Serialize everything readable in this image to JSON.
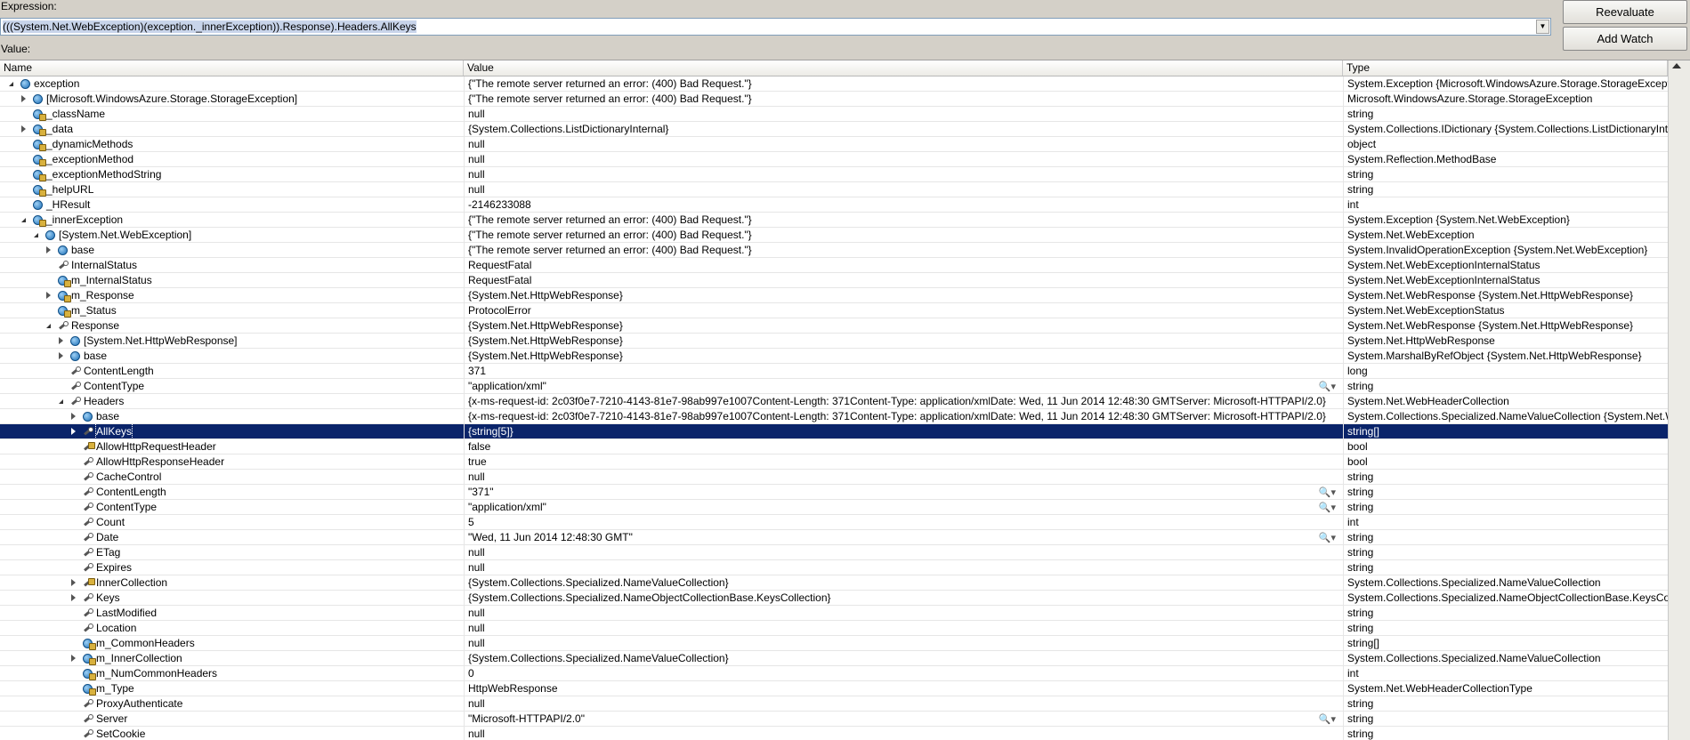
{
  "window": {
    "expression_label": "Expression:",
    "expression_value": "(((System.Net.WebException)(exception._innerException)).Response).Headers.AllKeys",
    "value_label": "Value:",
    "reevaluate_button": "Reevaluate",
    "add_watch_button": "Add Watch"
  },
  "grid": {
    "columns": [
      "Name",
      "Value",
      "Type"
    ],
    "rows": [
      {
        "name": "exception",
        "value": "{\"The remote server returned an error: (400) Bad Request.\"}",
        "type": "System.Exception {Microsoft.WindowsAzure.Storage.StorageException}",
        "depth": 0,
        "expander": "expanded",
        "icon": "field",
        "private": false,
        "mag": false
      },
      {
        "name": "[Microsoft.WindowsAzure.Storage.StorageException]",
        "value": "{\"The remote server returned an error: (400) Bad Request.\"}",
        "type": "Microsoft.WindowsAzure.Storage.StorageException",
        "depth": 1,
        "expander": "collapsed",
        "icon": "field",
        "private": false,
        "mag": false
      },
      {
        "name": "_className",
        "value": "null",
        "type": "string",
        "depth": 1,
        "expander": "none",
        "icon": "field",
        "private": true,
        "mag": false
      },
      {
        "name": "_data",
        "value": "{System.Collections.ListDictionaryInternal}",
        "type": "System.Collections.IDictionary {System.Collections.ListDictionaryInternal}",
        "depth": 1,
        "expander": "collapsed",
        "icon": "field",
        "private": true,
        "mag": false
      },
      {
        "name": "_dynamicMethods",
        "value": "null",
        "type": "object",
        "depth": 1,
        "expander": "none",
        "icon": "field",
        "private": true,
        "mag": false
      },
      {
        "name": "_exceptionMethod",
        "value": "null",
        "type": "System.Reflection.MethodBase",
        "depth": 1,
        "expander": "none",
        "icon": "field",
        "private": true,
        "mag": false
      },
      {
        "name": "_exceptionMethodString",
        "value": "null",
        "type": "string",
        "depth": 1,
        "expander": "none",
        "icon": "field",
        "private": true,
        "mag": false
      },
      {
        "name": "_helpURL",
        "value": "null",
        "type": "string",
        "depth": 1,
        "expander": "none",
        "icon": "field",
        "private": true,
        "mag": false
      },
      {
        "name": "_HResult",
        "value": "-2146233088",
        "type": "int",
        "depth": 1,
        "expander": "none",
        "icon": "field",
        "private": false,
        "mag": false
      },
      {
        "name": "_innerException",
        "value": "{\"The remote server returned an error: (400) Bad Request.\"}",
        "type": "System.Exception {System.Net.WebException}",
        "depth": 1,
        "expander": "expanded",
        "icon": "field",
        "private": true,
        "mag": false
      },
      {
        "name": "[System.Net.WebException]",
        "value": "{\"The remote server returned an error: (400) Bad Request.\"}",
        "type": "System.Net.WebException",
        "depth": 2,
        "expander": "expanded",
        "icon": "field",
        "private": false,
        "mag": false
      },
      {
        "name": "base",
        "value": "{\"The remote server returned an error: (400) Bad Request.\"}",
        "type": "System.InvalidOperationException {System.Net.WebException}",
        "depth": 3,
        "expander": "collapsed",
        "icon": "field",
        "private": false,
        "mag": false
      },
      {
        "name": "InternalStatus",
        "value": "RequestFatal",
        "type": "System.Net.WebExceptionInternalStatus",
        "depth": 3,
        "expander": "none",
        "icon": "prop",
        "private": false,
        "mag": false
      },
      {
        "name": "m_InternalStatus",
        "value": "RequestFatal",
        "type": "System.Net.WebExceptionInternalStatus",
        "depth": 3,
        "expander": "none",
        "icon": "field",
        "private": true,
        "mag": false
      },
      {
        "name": "m_Response",
        "value": "{System.Net.HttpWebResponse}",
        "type": "System.Net.WebResponse {System.Net.HttpWebResponse}",
        "depth": 3,
        "expander": "collapsed",
        "icon": "field",
        "private": true,
        "mag": false
      },
      {
        "name": "m_Status",
        "value": "ProtocolError",
        "type": "System.Net.WebExceptionStatus",
        "depth": 3,
        "expander": "none",
        "icon": "field",
        "private": true,
        "mag": false
      },
      {
        "name": "Response",
        "value": "{System.Net.HttpWebResponse}",
        "type": "System.Net.WebResponse {System.Net.HttpWebResponse}",
        "depth": 3,
        "expander": "expanded",
        "icon": "prop",
        "private": false,
        "mag": false
      },
      {
        "name": "[System.Net.HttpWebResponse]",
        "value": "{System.Net.HttpWebResponse}",
        "type": "System.Net.HttpWebResponse",
        "depth": 4,
        "expander": "collapsed",
        "icon": "field",
        "private": false,
        "mag": false
      },
      {
        "name": "base",
        "value": "{System.Net.HttpWebResponse}",
        "type": "System.MarshalByRefObject {System.Net.HttpWebResponse}",
        "depth": 4,
        "expander": "collapsed",
        "icon": "field",
        "private": false,
        "mag": false
      },
      {
        "name": "ContentLength",
        "value": "371",
        "type": "long",
        "depth": 4,
        "expander": "none",
        "icon": "prop",
        "private": false,
        "mag": false
      },
      {
        "name": "ContentType",
        "value": "\"application/xml\"",
        "type": "string",
        "depth": 4,
        "expander": "none",
        "icon": "prop",
        "private": false,
        "mag": true
      },
      {
        "name": "Headers",
        "value": "{x-ms-request-id: 2c03f0e7-7210-4143-81e7-98ab997e1007Content-Length: 371Content-Type: application/xmlDate: Wed, 11 Jun 2014 12:48:30 GMTServer: Microsoft-HTTPAPI/2.0}",
        "type": "System.Net.WebHeaderCollection",
        "depth": 4,
        "expander": "expanded",
        "icon": "prop",
        "private": false,
        "mag": false
      },
      {
        "name": "base",
        "value": "{x-ms-request-id: 2c03f0e7-7210-4143-81e7-98ab997e1007Content-Length: 371Content-Type: application/xmlDate: Wed, 11 Jun 2014 12:48:30 GMTServer: Microsoft-HTTPAPI/2.0}",
        "type": "System.Collections.Specialized.NameValueCollection {System.Net.W",
        "depth": 5,
        "expander": "collapsed",
        "icon": "field",
        "private": false,
        "mag": false
      },
      {
        "name": "AllKeys",
        "value": "{string[5]}",
        "type": "string[]",
        "depth": 5,
        "expander": "collapsed",
        "icon": "prop",
        "private": false,
        "mag": false,
        "selected": true
      },
      {
        "name": "AllowHttpRequestHeader",
        "value": "false",
        "type": "bool",
        "depth": 5,
        "expander": "none",
        "icon": "prop",
        "private": true,
        "mag": false
      },
      {
        "name": "AllowHttpResponseHeader",
        "value": "true",
        "type": "bool",
        "depth": 5,
        "expander": "none",
        "icon": "prop",
        "private": false,
        "mag": false
      },
      {
        "name": "CacheControl",
        "value": "null",
        "type": "string",
        "depth": 5,
        "expander": "none",
        "icon": "prop",
        "private": false,
        "mag": false
      },
      {
        "name": "ContentLength",
        "value": "\"371\"",
        "type": "string",
        "depth": 5,
        "expander": "none",
        "icon": "prop",
        "private": false,
        "mag": true
      },
      {
        "name": "ContentType",
        "value": "\"application/xml\"",
        "type": "string",
        "depth": 5,
        "expander": "none",
        "icon": "prop",
        "private": false,
        "mag": true
      },
      {
        "name": "Count",
        "value": "5",
        "type": "int",
        "depth": 5,
        "expander": "none",
        "icon": "prop",
        "private": false,
        "mag": false
      },
      {
        "name": "Date",
        "value": "\"Wed, 11 Jun 2014 12:48:30 GMT\"",
        "type": "string",
        "depth": 5,
        "expander": "none",
        "icon": "prop",
        "private": false,
        "mag": true
      },
      {
        "name": "ETag",
        "value": "null",
        "type": "string",
        "depth": 5,
        "expander": "none",
        "icon": "prop",
        "private": false,
        "mag": false
      },
      {
        "name": "Expires",
        "value": "null",
        "type": "string",
        "depth": 5,
        "expander": "none",
        "icon": "prop",
        "private": false,
        "mag": false
      },
      {
        "name": "InnerCollection",
        "value": "{System.Collections.Specialized.NameValueCollection}",
        "type": "System.Collections.Specialized.NameValueCollection",
        "depth": 5,
        "expander": "collapsed",
        "icon": "prop",
        "private": true,
        "mag": false
      },
      {
        "name": "Keys",
        "value": "{System.Collections.Specialized.NameObjectCollectionBase.KeysCollection}",
        "type": "System.Collections.Specialized.NameObjectCollectionBase.KeysColle",
        "depth": 5,
        "expander": "collapsed",
        "icon": "prop",
        "private": false,
        "mag": false
      },
      {
        "name": "LastModified",
        "value": "null",
        "type": "string",
        "depth": 5,
        "expander": "none",
        "icon": "prop",
        "private": false,
        "mag": false
      },
      {
        "name": "Location",
        "value": "null",
        "type": "string",
        "depth": 5,
        "expander": "none",
        "icon": "prop",
        "private": false,
        "mag": false
      },
      {
        "name": "m_CommonHeaders",
        "value": "null",
        "type": "string[]",
        "depth": 5,
        "expander": "none",
        "icon": "field",
        "private": true,
        "mag": false
      },
      {
        "name": "m_InnerCollection",
        "value": "{System.Collections.Specialized.NameValueCollection}",
        "type": "System.Collections.Specialized.NameValueCollection",
        "depth": 5,
        "expander": "collapsed",
        "icon": "field",
        "private": true,
        "mag": false
      },
      {
        "name": "m_NumCommonHeaders",
        "value": "0",
        "type": "int",
        "depth": 5,
        "expander": "none",
        "icon": "field",
        "private": true,
        "mag": false
      },
      {
        "name": "m_Type",
        "value": "HttpWebResponse",
        "type": "System.Net.WebHeaderCollectionType",
        "depth": 5,
        "expander": "none",
        "icon": "field",
        "private": true,
        "mag": false
      },
      {
        "name": "ProxyAuthenticate",
        "value": "null",
        "type": "string",
        "depth": 5,
        "expander": "none",
        "icon": "prop",
        "private": false,
        "mag": false
      },
      {
        "name": "Server",
        "value": "\"Microsoft-HTTPAPI/2.0\"",
        "type": "string",
        "depth": 5,
        "expander": "none",
        "icon": "prop",
        "private": false,
        "mag": true
      },
      {
        "name": "SetCookie",
        "value": "null",
        "type": "string",
        "depth": 5,
        "expander": "none",
        "icon": "prop",
        "private": false,
        "mag": false
      }
    ]
  },
  "icons": {
    "magnifier": "🔍▾"
  },
  "colors": {
    "selection": "#0a246a",
    "window_bg": "#d4d0c8"
  }
}
